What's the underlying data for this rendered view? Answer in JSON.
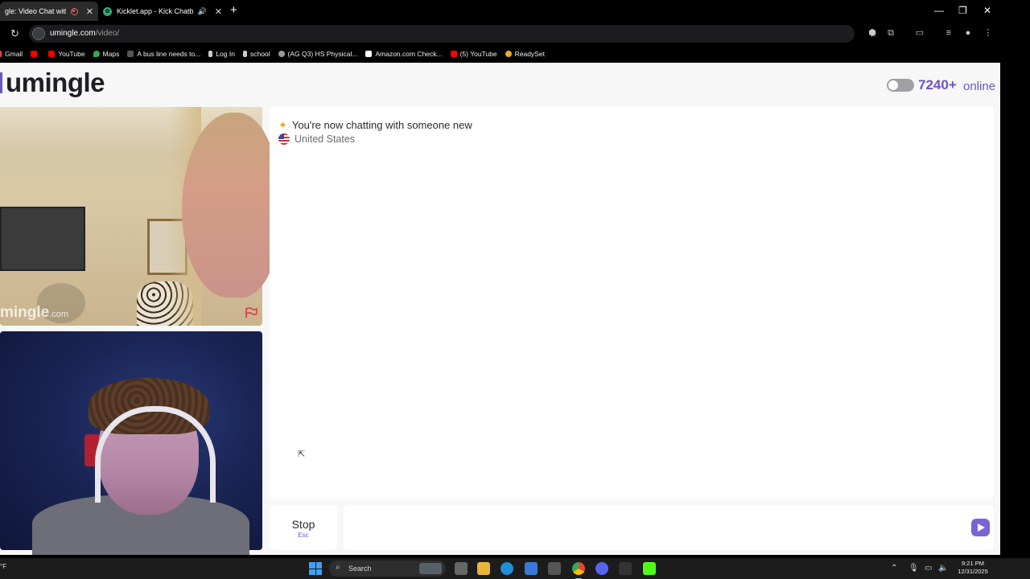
{
  "browser": {
    "tabs": [
      {
        "label": "gle: Video Chat with S",
        "active": true
      },
      {
        "label": "Kicklet.app - Kick Chatbot a",
        "active": false
      }
    ],
    "url_host": "umingle.com",
    "url_path": "/video/",
    "bookmarks": [
      {
        "label": "Gmail",
        "color": "#ea4335"
      },
      {
        "label": "",
        "color": "#ff0000"
      },
      {
        "label": "YouTube",
        "color": "#ff0000"
      },
      {
        "label": "Maps",
        "color": "#34a853"
      },
      {
        "label": "A bus line needs to...",
        "color": "#222222"
      },
      {
        "label": "Log In",
        "color": "#ffffff"
      },
      {
        "label": "school",
        "color": "#ffffff"
      },
      {
        "label": "(AG Q3) HS Physical...",
        "color": "#999999"
      },
      {
        "label": "Amazon.com Check...",
        "color": "#ffffff"
      },
      {
        "label": "(5) YouTube",
        "color": "#ff0000"
      },
      {
        "label": "ReadySet",
        "color": "#f4a425"
      }
    ]
  },
  "site": {
    "logo": "umingle",
    "online_count": "7240+",
    "online_label": "online",
    "watermark": "mingle",
    "watermark_suffix": ".com",
    "accent": "#6b56c9"
  },
  "chat": {
    "system_message": "You're now chatting with someone new",
    "country": "United States",
    "stop_label": "Stop",
    "stop_hint": "Esc",
    "input_value": "",
    "input_placeholder": ""
  },
  "taskbar": {
    "left_text": "°F",
    "search_label": "Search",
    "time": "9:21 PM",
    "date": "12/31/2025"
  }
}
